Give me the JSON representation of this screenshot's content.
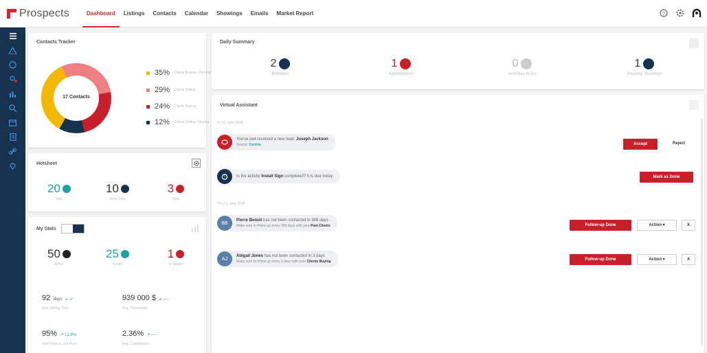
{
  "app": {
    "logo": "Prospects"
  },
  "nav": [
    "Dashboard",
    "Listings",
    "Contacts",
    "Calendar",
    "Showings",
    "Emails",
    "Market Report"
  ],
  "contacts_tracker": {
    "title": "Contacts Tracker",
    "center_label": "17 Contacts",
    "legend": [
      {
        "pct": "35%",
        "label": "Clients Buying - Renting",
        "color": "#f5b800"
      },
      {
        "pct": "29%",
        "label": "Clients Selling",
        "color": "#f07f84"
      },
      {
        "pct": "24%",
        "label": "Clients Buying",
        "color": "#c8202a"
      },
      {
        "pct": "12%",
        "label": "Clients Selling / Buying",
        "color": "#16324f"
      }
    ],
    "chart_data": {
      "type": "pie",
      "categories": [
        "Clients Buying - Renting",
        "Clients Selling",
        "Clients Buying",
        "Clients Selling / Buying"
      ],
      "values": [
        35,
        29,
        24,
        12
      ],
      "title": "Contacts Tracker"
    }
  },
  "hotsheet": {
    "title": "Hotsheet",
    "stats": [
      {
        "value": "20",
        "label": "New",
        "color": "#1aa3a3"
      },
      {
        "value": "10",
        "label": "Price Drop",
        "color": "#16324f"
      },
      {
        "value": "3",
        "label": "Sold",
        "color": "#c8202a"
      }
    ]
  },
  "my_stats": {
    "title": "My Stats",
    "stats": [
      {
        "value": "50",
        "label": "Active",
        "color": "#222"
      },
      {
        "value": "25",
        "label": "Pends",
        "color": "#1aa3a3"
      },
      {
        "value": "1",
        "label": "To Market",
        "color": "#c8202a"
      }
    ],
    "metrics": [
      {
        "value": "92",
        "unit": "days",
        "trend": "↙ ↙",
        "label": "Avg. Selling Time"
      },
      {
        "value": "939 000 $",
        "unit": "",
        "trend": "↙ ---",
        "label": "Avg. Transaction"
      },
      {
        "value": "95%",
        "unit": "",
        "trend": "↗ 12.8%",
        "label": "Sold Price vs List Price"
      },
      {
        "value": "2.36%",
        "unit": "",
        "trend": "↗ ----",
        "label": "Avg. Commission"
      }
    ]
  },
  "daily_summary": {
    "title": "Daily Summary",
    "items": [
      {
        "value": "2",
        "label": "Birthdays",
        "color": "#16324f",
        "icon": "cake-icon"
      },
      {
        "value": "1",
        "label": "Appointments",
        "color": "#c8202a",
        "icon": "calendar-icon"
      },
      {
        "value": "0",
        "label": "Activities to Do",
        "color": "#bbb",
        "icon": "clipboard-icon"
      },
      {
        "value": "1",
        "label": "Property Showings",
        "color": "#16324f",
        "icon": "house-icon"
      }
    ]
  },
  "virtual_assistant": {
    "title": "Virtual Assistant",
    "dates": [
      "Fri 22 June 2018",
      "Thu 21 June 2018"
    ],
    "messages": [
      {
        "avatar": "",
        "pre": "You've just received a new lead: ",
        "bold": "Joseph Jackson",
        "post": "",
        "sub_pre": "Source: ",
        "sub_bold": "Centris",
        "sub_post": ""
      },
      {
        "avatar": "",
        "pre": "Is the activity ",
        "bold": "Install Sign",
        "post": " completed? It is due today.",
        "sub_pre": "",
        "sub_bold": "",
        "sub_post": ""
      },
      {
        "avatar": "BB",
        "pre": "",
        "bold": "Pierre Benoit",
        "post": " has not been contacted in 366 days",
        "sub_pre": "Make sure to follow up every 365 days with your ",
        "sub_bold": "Past Clients",
        "sub_post": ""
      },
      {
        "avatar": "AJ",
        "pre": "",
        "bold": "Abigail Jones",
        "post": " has not been contacted in 3 days",
        "sub_pre": "Make sure to follow up every 2 days with your ",
        "sub_bold": "Clients Buying",
        "sub_post": ""
      }
    ],
    "buttons": {
      "accept": "Accept",
      "reject": "Reject",
      "mark_done": "Mark as Done",
      "followup_done": "Follow-up Done",
      "action": "Action",
      "close": "X"
    }
  }
}
